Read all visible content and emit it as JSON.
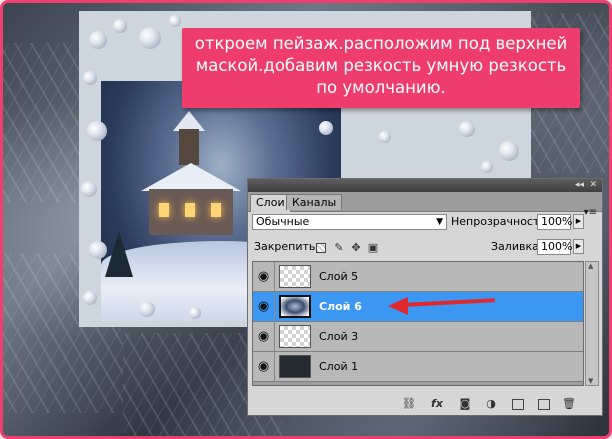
{
  "callout": {
    "text": "откроем пейзаж.расположим под верхней маской.добавим резкость умную резкость по умолчанию."
  },
  "panel": {
    "tabs": [
      {
        "label": "Слои",
        "active": true
      },
      {
        "label": "Каналы",
        "active": false
      }
    ],
    "collapse_icon": "double-chevron-icon",
    "close_icon": "close-icon",
    "menu_icon": "panel-menu-icon",
    "blend_mode": "Обычные",
    "opacity_label": "Непрозрачность:",
    "opacity_value": "100%",
    "lock_label": "Закрепить:",
    "fill_label": "Заливка:",
    "fill_value": "100%",
    "lock_icons": [
      "lock-transparency-icon",
      "lock-image-icon",
      "lock-position-icon",
      "lock-all-icon"
    ],
    "layers": [
      {
        "name": "Слой 5",
        "thumbnail": "transparent",
        "visible": true,
        "selected": false
      },
      {
        "name": "Слой 6",
        "thumbnail": "photo",
        "visible": true,
        "selected": true
      },
      {
        "name": "Слой 3",
        "thumbnail": "transparent",
        "visible": true,
        "selected": false
      },
      {
        "name": "Слой 1",
        "thumbnail": "dark",
        "visible": true,
        "selected": false
      }
    ],
    "footer_icons": [
      "link-layers-icon",
      "fx-icon",
      "add-mask-icon",
      "adjustment-layer-icon",
      "new-group-icon",
      "new-layer-icon",
      "trash-icon"
    ],
    "fx_label": "fx"
  },
  "colors": {
    "frame": "#ef3f6f",
    "callout_bg": "#ee3d6d",
    "selection": "#3b97f2",
    "arrow": "#e0282d"
  }
}
